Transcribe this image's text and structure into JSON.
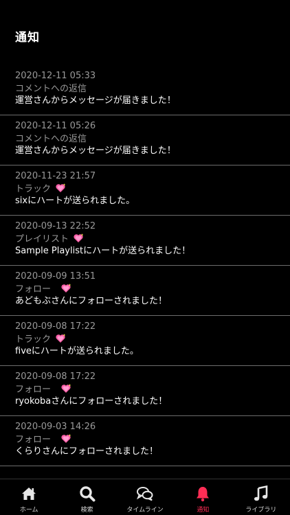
{
  "header": {
    "title": "通知"
  },
  "notifications": [
    {
      "date": "2020-12-11 05:33",
      "type": "コメントへの返信",
      "message": "運営さんからメッセージが届きました！",
      "heart": false
    },
    {
      "date": "2020-12-11 05:26",
      "type": "コメントへの返信",
      "message": "運営さんからメッセージが届きました！",
      "heart": false
    },
    {
      "date": "2020-11-23 21:57",
      "type": "トラック",
      "message": "sixにハートが送られました。",
      "heart": true
    },
    {
      "date": "2020-09-13 22:52",
      "type": "プレイリスト",
      "message": "Sample Playlistにハートが送られました！",
      "heart": true
    },
    {
      "date": "2020-09-09 13:51",
      "type": "フォロー",
      "message": "あどもぶさんにフォローされました！",
      "heart": true
    },
    {
      "date": "2020-09-08 17:22",
      "type": "トラック",
      "message": "fiveにハートが送られました。",
      "heart": true
    },
    {
      "date": "2020-09-08 17:22",
      "type": "フォロー",
      "message": "ryokobaさんにフォローされました！",
      "heart": true
    },
    {
      "date": "2020-09-03 14:26",
      "type": "フォロー",
      "message": "くらりさんにフォローされました！",
      "heart": true
    }
  ],
  "tabs": [
    {
      "label": "ホーム",
      "icon": "home-icon",
      "active": false
    },
    {
      "label": "検索",
      "icon": "search-icon",
      "active": false
    },
    {
      "label": "タイムライン",
      "icon": "chat-icon",
      "active": false
    },
    {
      "label": "通知",
      "icon": "bell-icon",
      "active": true
    },
    {
      "label": "ライブラリ",
      "icon": "music-icon",
      "active": false
    }
  ],
  "colors": {
    "accent": "#ff2d55",
    "muted": "#9a9a9a",
    "divider": "#6e6e6e"
  }
}
